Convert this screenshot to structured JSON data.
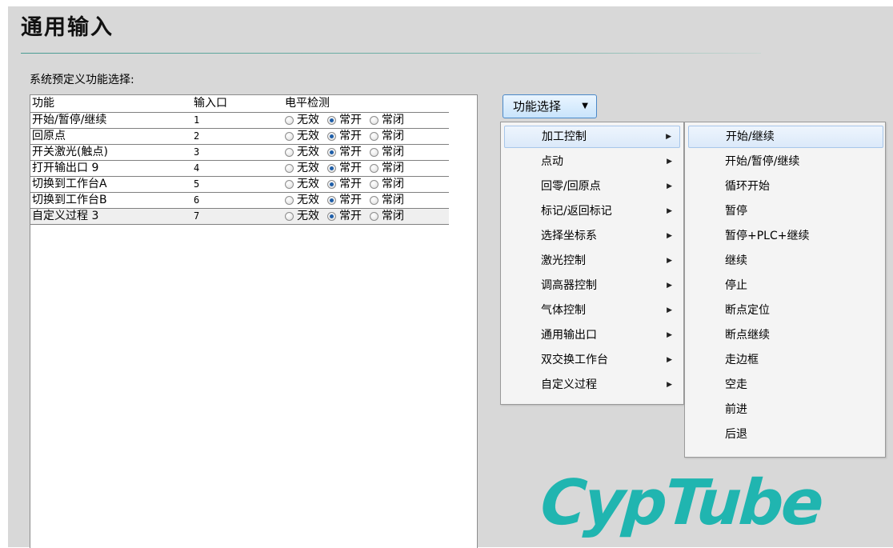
{
  "page": {
    "title": "通用输入"
  },
  "section_label": "系统预定义功能选择:",
  "table": {
    "headers": {
      "function": "功能",
      "port": "输入口",
      "level": "电平检测"
    },
    "radio_labels": [
      "无效",
      "常开",
      "常闭"
    ],
    "rows": [
      {
        "function": "开始/暂停/继续",
        "port": "1",
        "selected": "常开"
      },
      {
        "function": "回原点",
        "port": "2",
        "selected": "常开"
      },
      {
        "function": "开关激光(触点)",
        "port": "3",
        "selected": "常开"
      },
      {
        "function": "打开输出口 9",
        "port": "4",
        "selected": "常开"
      },
      {
        "function": "切换到工作台A",
        "port": "5",
        "selected": "常开"
      },
      {
        "function": "切换到工作台B",
        "port": "6",
        "selected": "常开"
      },
      {
        "function": "自定义过程 3",
        "port": "7",
        "selected": "常开"
      }
    ]
  },
  "function_button": {
    "label": "功能选择",
    "caret": "▼"
  },
  "menu": {
    "items": [
      {
        "label": "加工控制",
        "highlighted": true
      },
      {
        "label": "点动"
      },
      {
        "label": "回零/回原点"
      },
      {
        "label": "标记/返回标记"
      },
      {
        "label": "选择坐标系"
      },
      {
        "label": "激光控制"
      },
      {
        "label": "调高器控制"
      },
      {
        "label": "气体控制"
      },
      {
        "label": "通用输出口"
      },
      {
        "label": "双交换工作台"
      },
      {
        "label": "自定义过程"
      }
    ],
    "submenu_arrow": "▶"
  },
  "submenu": {
    "items": [
      {
        "label": "开始/继续",
        "highlighted": true
      },
      {
        "label": "开始/暂停/继续"
      },
      {
        "label": "循环开始"
      },
      {
        "label": "暂停"
      },
      {
        "label": "暂停+PLC+继续"
      },
      {
        "label": "继续"
      },
      {
        "label": "停止"
      },
      {
        "label": "断点定位"
      },
      {
        "label": "断点继续"
      },
      {
        "label": "走边框"
      },
      {
        "label": "空走"
      },
      {
        "label": "前进"
      },
      {
        "label": "后退"
      }
    ]
  },
  "logo": {
    "text": "CypTube",
    "color": "#20b5b0"
  }
}
